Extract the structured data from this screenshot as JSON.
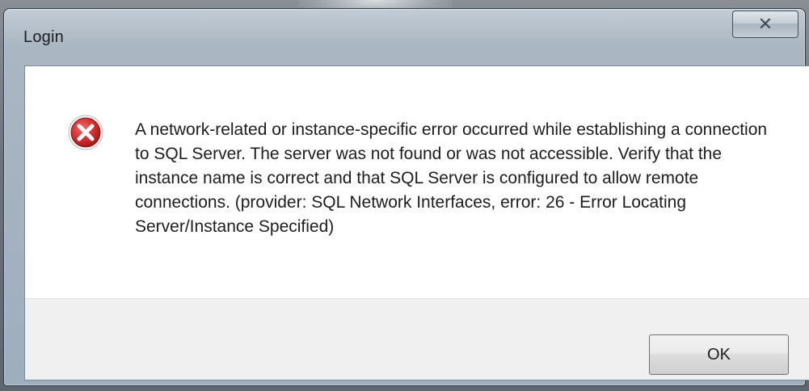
{
  "window": {
    "title": "Login",
    "close_glyph": "✕"
  },
  "dialog": {
    "icon": "error-icon",
    "message": "A network-related or instance-specific error occurred while establishing a connection to SQL Server. The server was not found or was not accessible. Verify that the instance name is correct and that SQL Server is configured to allow remote connections. (provider: SQL Network Interfaces, error: 26 - Error Locating Server/Instance Specified)",
    "ok_label": "OK"
  },
  "colors": {
    "error_red": "#d12b2b",
    "title_bar": "#aab6c2",
    "footer": "#f0f0f0"
  }
}
